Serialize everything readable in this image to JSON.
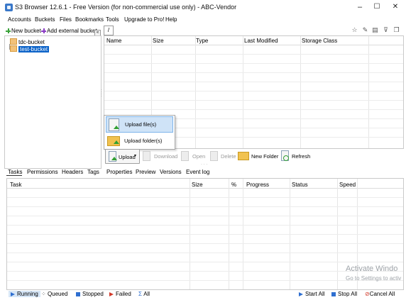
{
  "window": {
    "title": "S3 Browser 12.6.1 - Free Version (for non-commercial use only) - ABC-Vendor",
    "minimize_glyph": "–",
    "maximize_glyph": "☐",
    "close_glyph": "✕"
  },
  "menu": [
    "Accounts",
    "Buckets",
    "Files",
    "Bookmarks",
    "Tools",
    "Upgrade to Pro!",
    "Help"
  ],
  "toolbar": {
    "new_bucket": "New bucket",
    "add_external_bucket": "Add external bucket",
    "collapse_glyph": "«"
  },
  "buckets": [
    "tdc-bucket",
    "test-bucket"
  ],
  "path": "/",
  "file_columns": [
    "Name",
    "Size",
    "Type",
    "Last Modified",
    "Storage Class"
  ],
  "upload_menu": {
    "upload_files": "Upload file(s)",
    "upload_folder": "Upload folder(s)"
  },
  "actions": {
    "upload": "Upload",
    "download": "Download",
    "open": "Open",
    "delete": "Delete",
    "new_folder": "New Folder",
    "refresh": "Refresh"
  },
  "tabs": [
    "Tasks",
    "Permissions",
    "Headers",
    "Tags",
    "Properties",
    "Preview",
    "Versions",
    "Event log"
  ],
  "task_columns": [
    "Task",
    "Size",
    "%",
    "Progress",
    "Status",
    "Speed"
  ],
  "status_bar": {
    "running": "Running",
    "queued": "Queued",
    "stopped": "Stopped",
    "failed": "Failed",
    "all": "All",
    "start_all": "Start All",
    "stop_all": "Stop All",
    "cancel_all": "Cancel All"
  },
  "watermark": {
    "title": "Activate Windo",
    "subtitle": "Go to Settings to activ"
  },
  "colors": {
    "selection": "#0a62c8",
    "menu_highlight": "#cfe3f7",
    "upload_green": "#32a033",
    "folder_yellow": "#f1c24f"
  }
}
